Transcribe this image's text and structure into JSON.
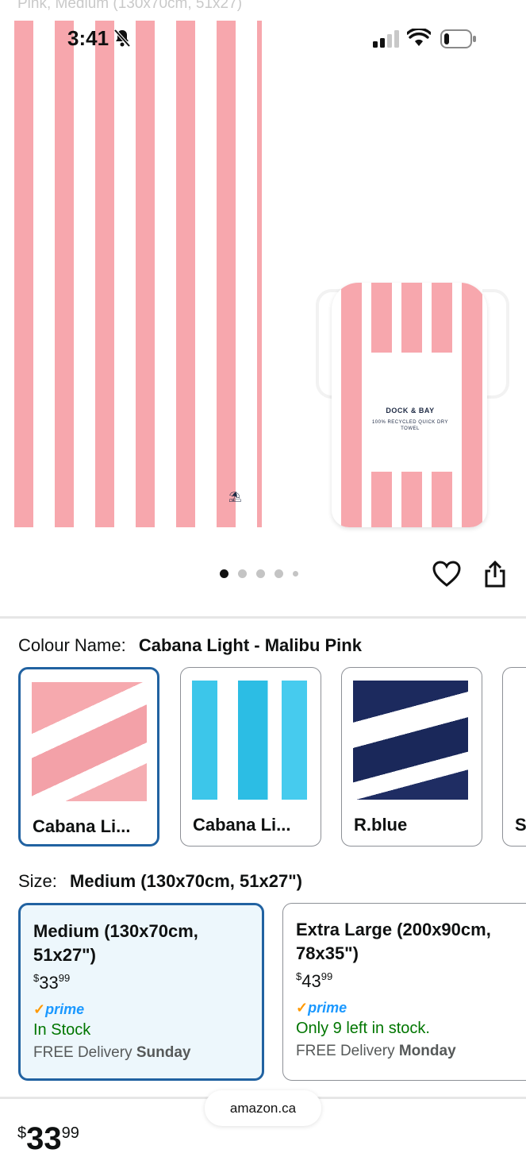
{
  "faded_title": "Pink, Medium (130x70cm, 51x27)",
  "status_bar": {
    "time": "3:41"
  },
  "gallery": {
    "bag_brand": "DOCK & BAY",
    "bag_subtitle": "100% RECYCLED QUICK DRY TOWEL",
    "page_count": 5,
    "active_index": 0
  },
  "colour": {
    "label": "Colour Name:",
    "value": "Cabana Light - Malibu Pink",
    "options": [
      {
        "name": "Cabana Li...",
        "selected": true
      },
      {
        "name": "Cabana Li...",
        "selected": false
      },
      {
        "name": "R.blue",
        "selected": false
      },
      {
        "name": "S",
        "selected": false
      }
    ]
  },
  "size": {
    "label": "Size:",
    "value": "Medium (130x70cm, 51x27\")",
    "options": [
      {
        "name_line1": "Medium (130x70cm,",
        "name_line2": "51x27\")",
        "currency": "$",
        "price_whole": "33",
        "price_cents": "99",
        "prime": "prime",
        "stock": "In Stock",
        "delivery_prefix": "FREE Delivery",
        "delivery_day": "Sunday"
      },
      {
        "name_line1": "Extra Large (200x90cm,",
        "name_line2": "78x35\")",
        "currency": "$",
        "price_whole": "43",
        "price_cents": "99",
        "prime": "prime",
        "stock": "Only 9 left in stock.",
        "delivery_prefix": "FREE Delivery",
        "delivery_day": "Monday"
      }
    ]
  },
  "footer": {
    "domain": "amazon.ca",
    "currency": "$",
    "price_whole": "33",
    "price_cents": "99"
  },
  "colors": {
    "accent_blue": "#2162a1",
    "stock_green": "#007600",
    "prime_blue": "#1a98ff",
    "prime_orange": "#ff9900",
    "towel_pink": "#f7a7ad"
  }
}
